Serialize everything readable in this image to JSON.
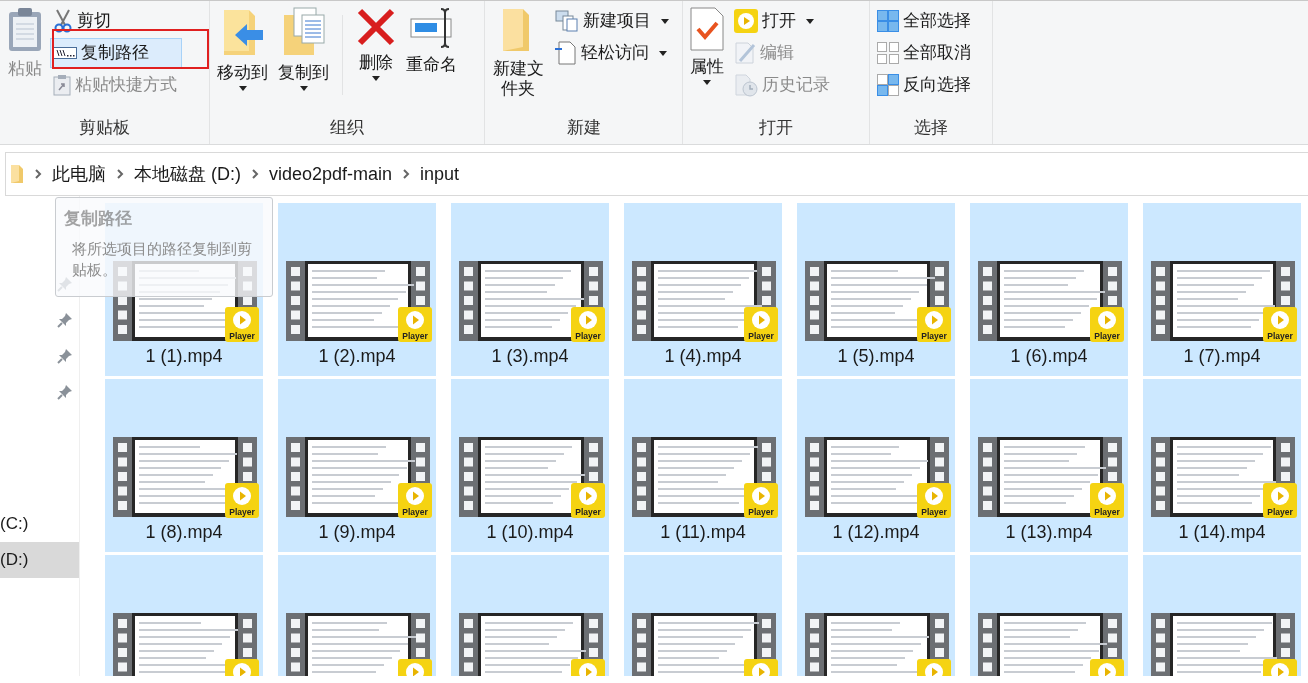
{
  "ribbon": {
    "groups": [
      {
        "label": "剪贴板",
        "large": [
          {
            "label": "粘贴",
            "disabled": true,
            "dropdown": false
          }
        ],
        "small": [
          {
            "label": "剪切",
            "disabled": false,
            "dropdown": false,
            "highlighted": false
          },
          {
            "label": "复制路径",
            "disabled": false,
            "dropdown": false,
            "highlighted": true
          },
          {
            "label": "粘贴快捷方式",
            "disabled": true,
            "dropdown": false,
            "highlighted": false
          }
        ]
      },
      {
        "label": "组织",
        "large": [
          {
            "label": "移动到",
            "disabled": false,
            "dropdown": true,
            "divider_before": false
          },
          {
            "label": "复制到",
            "disabled": false,
            "dropdown": true,
            "divider_before": false
          },
          {
            "label": "删除",
            "disabled": false,
            "dropdown": true,
            "divider_before": true
          },
          {
            "label": "重命名",
            "disabled": false,
            "dropdown": false,
            "divider_before": false
          }
        ]
      },
      {
        "label": "新建",
        "large": [
          {
            "label": "新建文件夹",
            "disabled": false,
            "dropdown": false
          }
        ],
        "small": [
          {
            "label": "新建项目",
            "disabled": false,
            "dropdown": true,
            "highlighted": false
          },
          {
            "label": "轻松访问",
            "disabled": false,
            "dropdown": true,
            "highlighted": false
          }
        ]
      },
      {
        "label": "打开",
        "large": [
          {
            "label": "属性",
            "disabled": false,
            "dropdown": true
          }
        ],
        "small": [
          {
            "label": "打开",
            "disabled": false,
            "dropdown": true,
            "highlighted": false
          },
          {
            "label": "编辑",
            "disabled": true,
            "dropdown": false,
            "highlighted": false
          },
          {
            "label": "历史记录",
            "disabled": true,
            "dropdown": false,
            "highlighted": false
          }
        ]
      },
      {
        "label": "选择",
        "small": [
          {
            "label": "全部选择",
            "disabled": false,
            "dropdown": false,
            "highlighted": false
          },
          {
            "label": "全部取消",
            "disabled": false,
            "dropdown": false,
            "highlighted": false
          },
          {
            "label": "反向选择",
            "disabled": false,
            "dropdown": false,
            "highlighted": false
          }
        ]
      }
    ]
  },
  "address_bar": {
    "segments": [
      "此电脑",
      "本地磁盘 (D:)",
      "video2pdf-main",
      "input"
    ]
  },
  "tooltip": {
    "title": "复制路径",
    "text": "将所选项目的路径复制到剪贴板。"
  },
  "nav": {
    "quick_access": [
      {
        "pinned": true
      },
      {
        "pinned": true
      },
      {
        "pinned": true
      },
      {
        "pinned": true
      }
    ],
    "drives": [
      {
        "label": "(C:)",
        "selected": false
      },
      {
        "label": "(D:)",
        "selected": true
      }
    ]
  },
  "files": [
    {
      "name": "1 (1).mp4",
      "badge": "Player",
      "selected": true
    },
    {
      "name": "1 (2).mp4",
      "badge": "Player",
      "selected": true
    },
    {
      "name": "1 (3).mp4",
      "badge": "Player",
      "selected": true
    },
    {
      "name": "1 (4).mp4",
      "badge": "Player",
      "selected": true
    },
    {
      "name": "1 (5).mp4",
      "badge": "Player",
      "selected": true
    },
    {
      "name": "1 (6).mp4",
      "badge": "Player",
      "selected": true
    },
    {
      "name": "1 (7).mp4",
      "badge": "Player",
      "selected": true
    },
    {
      "name": "1 (8).mp4",
      "badge": "Player",
      "selected": true
    },
    {
      "name": "1 (9).mp4",
      "badge": "Player",
      "selected": true
    },
    {
      "name": "1 (10).mp4",
      "badge": "Player",
      "selected": true
    },
    {
      "name": "1 (11).mp4",
      "badge": "Player",
      "selected": true
    },
    {
      "name": "1 (12).mp4",
      "badge": "Player",
      "selected": true
    },
    {
      "name": "1 (13).mp4",
      "badge": "Player",
      "selected": true
    },
    {
      "name": "1 (14).mp4",
      "badge": "Player",
      "selected": true
    },
    {
      "selected": true
    },
    {
      "selected": true
    },
    {
      "selected": true
    },
    {
      "selected": true
    },
    {
      "selected": true
    },
    {
      "selected": true
    },
    {
      "selected": true
    }
  ]
}
